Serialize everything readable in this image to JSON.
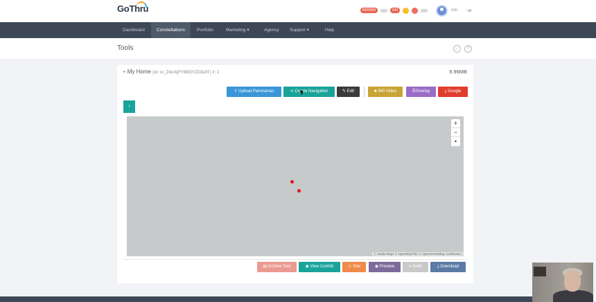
{
  "brand": {
    "logo_text": "GoThru"
  },
  "header": {
    "notification_pill_1": "0000000",
    "notification_pill_2": "642",
    "user_name": "Alin",
    "logout_icon": "logout-icon"
  },
  "nav": {
    "items": [
      {
        "label": "Dashboard"
      },
      {
        "label": "Constellations"
      },
      {
        "label": "Portfolio"
      },
      {
        "label": "Marketing ▾"
      },
      {
        "label": "Agency"
      },
      {
        "label": "Support ▾"
      },
      {
        "label": "Help"
      }
    ],
    "active_index": 1
  },
  "page": {
    "title": "Tools"
  },
  "card": {
    "title": "My Home",
    "subtitle": "(id: sv_ZIkxXjPY9MDYZD3e3T) #: 2",
    "size": "9.96MB",
    "tab_chip": "i"
  },
  "toolbar_top": {
    "upload": "Upload Panoramas",
    "create_nav": "Create Navigation",
    "edit": "Edit",
    "video": "360 Video",
    "overlay": "Overlay",
    "google": "Google"
  },
  "map": {
    "zoom_in": "+",
    "zoom_out": "−",
    "reset_north": "▴",
    "attribution": "© Stadia Maps © OpenMapTiles © OpenStreetMap contributors",
    "pins": 2
  },
  "toolbar_bottom": {
    "archive": "Archive Tour",
    "view_contrib": "View Contrib",
    "star": "Star",
    "preview": "Preview",
    "nadir": "Nadir",
    "download": "Download"
  },
  "colors": {
    "nav_bg": "#3d4756",
    "blue": "#3a96d8",
    "teal": "#1aa39a",
    "dark": "#3b3b3b",
    "gold": "#c9a434",
    "purple": "#9b6bc7",
    "red": "#e03d2f"
  }
}
